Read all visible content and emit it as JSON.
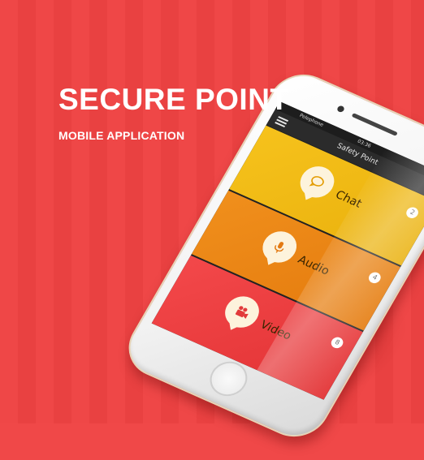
{
  "hero": {
    "title": "SECURE POINT",
    "subtitle": "MOBILE APPLICATION"
  },
  "phone": {
    "status": {
      "carrier": "Pelephone",
      "time": "03:36"
    },
    "header": {
      "title": "Safety Point",
      "menu_icon": "hamburger-icon"
    },
    "cards": [
      {
        "label": "Chat",
        "badge": "2",
        "icon": "chat-icon",
        "color": "#f6c21c"
      },
      {
        "label": "Audio",
        "badge": "4",
        "icon": "microphone-icon",
        "color": "#f08f1c"
      },
      {
        "label": "Video",
        "badge": "8",
        "icon": "video-camera-icon",
        "color": "#f3484a"
      }
    ]
  },
  "colors": {
    "background": "#ef4747",
    "text": "#ffffff"
  }
}
